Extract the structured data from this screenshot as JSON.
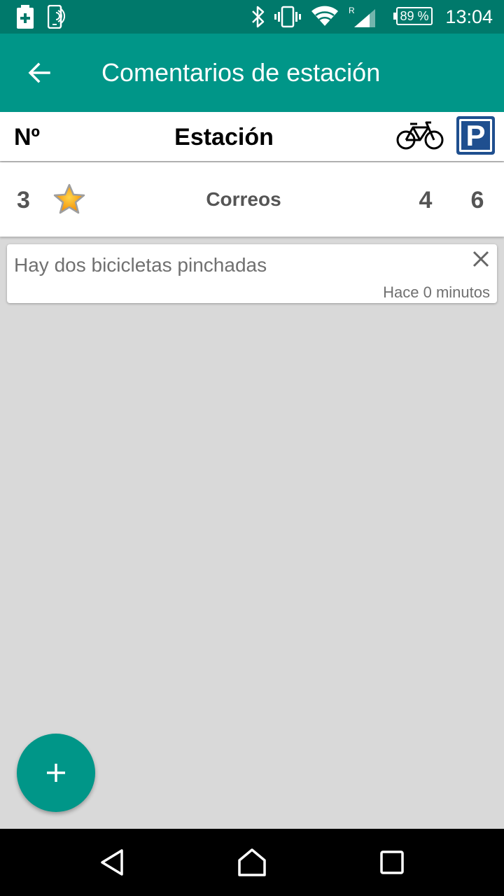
{
  "status_bar": {
    "time": "13:04",
    "battery_percent": "89 %",
    "icons": [
      "battery-charging-icon",
      "nfc-phone-icon",
      "bluetooth-icon",
      "vibrate-icon",
      "wifi-icon",
      "signal-roaming-icon"
    ],
    "roaming_label": "R"
  },
  "app_bar": {
    "title": "Comentarios de estación",
    "back_icon": "arrow-back-icon"
  },
  "table_header": {
    "number_label": "Nº",
    "station_label": "Estación",
    "bikes_icon": "bicycle-icon",
    "parking_icon": "parking-icon",
    "parking_letter": "P"
  },
  "station": {
    "number": "3",
    "favorite_icon": "star-icon",
    "name": "Correos",
    "bikes_available": "4",
    "free_slots": "6"
  },
  "comments": [
    {
      "text": "Hay dos bicicletas pinchadas",
      "time": "Hace 0 minutos",
      "delete_icon": "close-icon"
    }
  ],
  "fab": {
    "icon": "plus-icon"
  },
  "nav_bar": {
    "icons": [
      "back-triangle-icon",
      "home-icon",
      "recents-icon"
    ]
  },
  "colors": {
    "status_bar": "#00796b",
    "primary": "#009688",
    "background": "#d9d9d9",
    "parking_blue": "#1f4f8f"
  }
}
